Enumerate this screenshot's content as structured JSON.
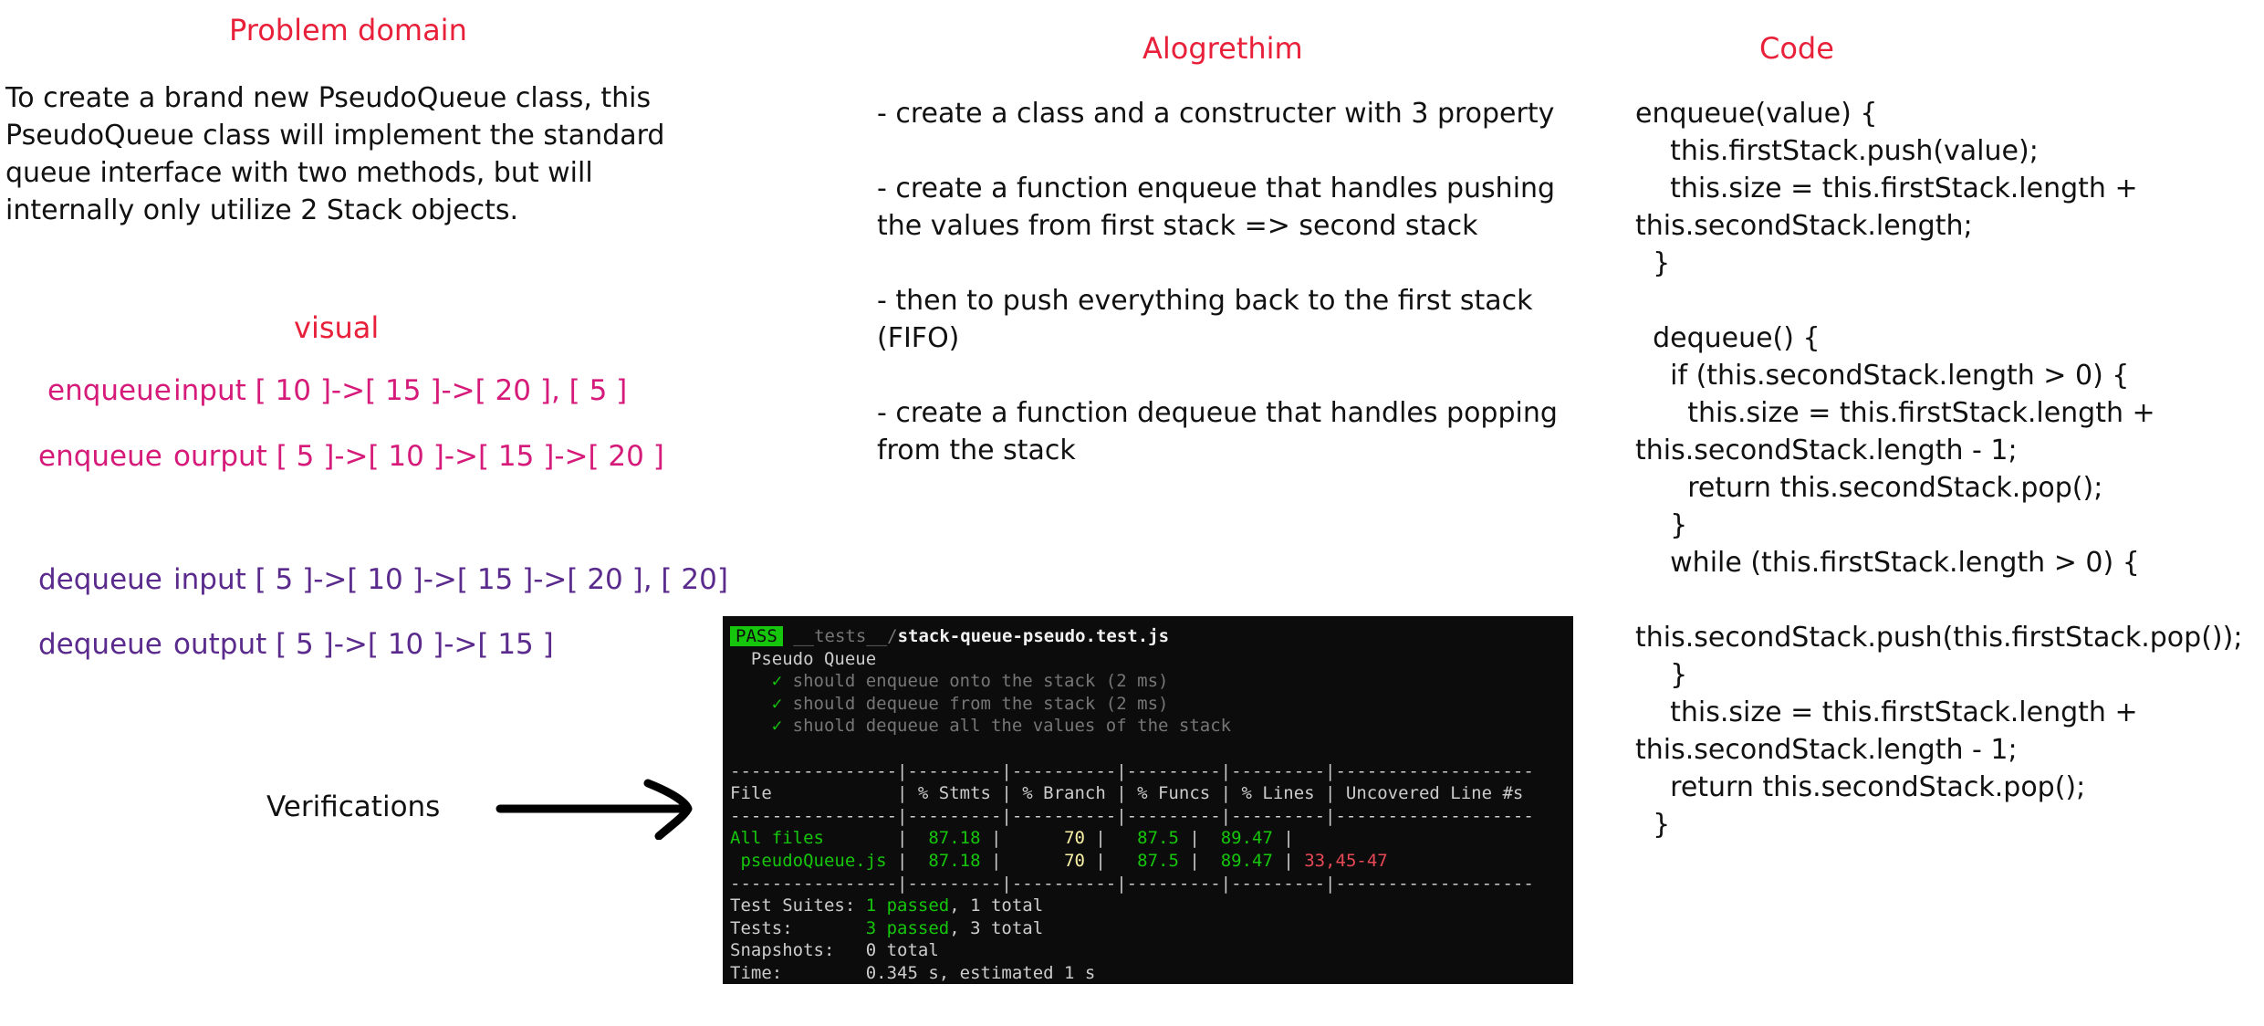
{
  "problem": {
    "heading": "Problem domain",
    "text": "To create a brand new PseudoQueue class, this PseudoQueue class will implement the standard queue interface with two methods, but will internally only utilize 2 Stack objects."
  },
  "visual": {
    "heading": "visual",
    "rows": [
      {
        "op": "enqueue",
        "desc": "input [ 10 ]->[ 15 ]->[ 20 ], [ 5 ]"
      },
      {
        "op": "enqueue",
        "desc": "ourput [ 5 ]->[ 10 ]->[ 15 ]->[ 20 ]"
      },
      {
        "op": "dequeue",
        "desc": "input [ 5 ]->[ 10 ]->[ 15 ]->[ 20 ], [ 20]"
      },
      {
        "op": "dequeue",
        "desc": "output [ 5 ]->[ 10 ]->[ 15 ]"
      }
    ]
  },
  "verifications": {
    "label": "Verifications"
  },
  "algorithm": {
    "heading": "Alogrethim",
    "steps": [
      "- create a class and a constructer with 3 property",
      "- create a function enqueue that handles pushing the values from first stack => second stack",
      "- then to push everything back to the first stack (FIFO)",
      "- create a function dequeue that handles popping from the stack"
    ]
  },
  "code": {
    "heading": "Code",
    "lines": [
      "enqueue(value) {",
      "    this.firstStack.push(value);",
      "    this.size = this.firstStack.length +",
      "this.secondStack.length;",
      "  }",
      "",
      "  dequeue() {",
      "    if (this.secondStack.length > 0) {",
      "      this.size = this.firstStack.length +",
      "this.secondStack.length - 1;",
      "      return this.secondStack.pop();",
      "    }",
      "    while (this.firstStack.length > 0) {",
      "",
      "this.secondStack.push(this.firstStack.pop());",
      "    }",
      "    this.size = this.firstStack.length +",
      "this.secondStack.length - 1;",
      "    return this.secondStack.pop();",
      "  }"
    ]
  },
  "terminal": {
    "badge": "PASS",
    "path_dir": "__tests__/",
    "path_file": "stack-queue-pseudo.test.js",
    "suite": "  Pseudo Queue",
    "tests": [
      "    ✓ should enqueue onto the stack (2 ms)",
      "    ✓ should dequeue from the stack (2 ms)",
      "    ✓ shuold dequeue all the values of the stack"
    ],
    "separator": "----------------|---------|----------|---------|---------|-------------------",
    "header_row": "File            | % Stmts | % Branch | % Funcs | % Lines | Uncovered Line #s ",
    "all_files": {
      "name": "All files       ",
      "stmts": "  87.18 ",
      "branch": "      70 ",
      "funcs": "   87.5 ",
      "lines": "  89.47 ",
      "uncovered": ""
    },
    "file_row": {
      "name": " pseudoQueue.js ",
      "stmts": "  87.18 ",
      "branch": "      70 ",
      "funcs": "   87.5 ",
      "lines": "  89.47 ",
      "uncovered": " 33,45-47"
    },
    "summary": {
      "suites_label": "Test Suites: ",
      "suites_passed": "1 passed",
      "suites_total": ", 1 total",
      "tests_label": "Tests:       ",
      "tests_passed": "3 passed",
      "tests_total": ", 3 total",
      "snapshots": "Snapshots:   0 total",
      "time": "Time:        0.345 s, estimated 1 s"
    }
  }
}
